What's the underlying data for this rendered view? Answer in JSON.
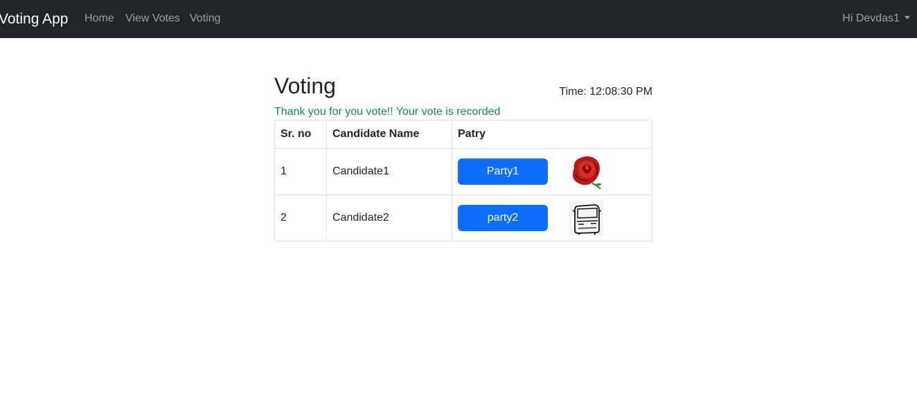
{
  "navbar": {
    "brand": "Voting App",
    "links": [
      "Home",
      "View Votes",
      "Voting"
    ],
    "user_label": "Hi Devdas1"
  },
  "main": {
    "title": "Voting",
    "time_label": "Time: 12:08:30 PM",
    "success_message": "Thank you for you vote!! Your vote is recorded",
    "table": {
      "headers": [
        "Sr. no",
        "Candidate Name",
        "Patry"
      ],
      "rows": [
        {
          "sr": "1",
          "name": "Candidate1",
          "party": "Party1",
          "symbol": "rose-icon"
        },
        {
          "sr": "2",
          "name": "Candidate2",
          "party": "party2",
          "symbol": "bus-icon"
        }
      ]
    }
  },
  "colors": {
    "navbar_bg": "#212529",
    "button_primary": "#0d6efd",
    "success_text": "#198754"
  }
}
